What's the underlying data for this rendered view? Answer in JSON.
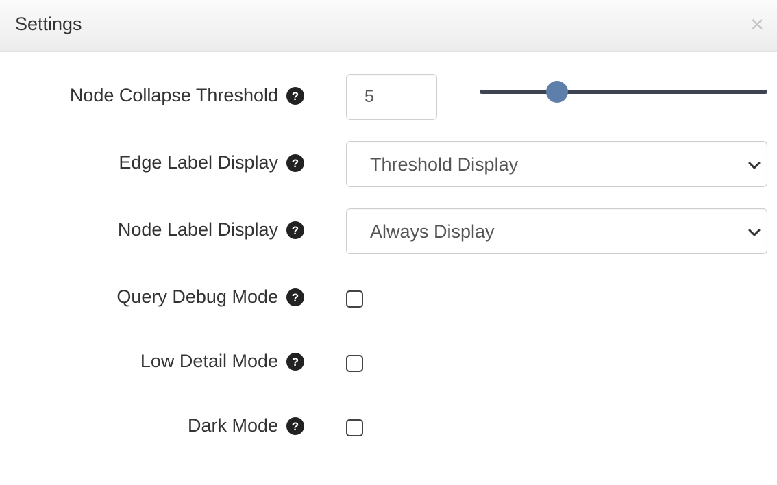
{
  "dialog": {
    "title": "Settings",
    "close_glyph": "×"
  },
  "settings": {
    "node_collapse_threshold": {
      "label": "Node Collapse Threshold",
      "value": "5",
      "slider_fraction": 0.27
    },
    "edge_label_display": {
      "label": "Edge Label Display",
      "selected": "Threshold Display"
    },
    "node_label_display": {
      "label": "Node Label Display",
      "selected": "Always Display"
    },
    "query_debug_mode": {
      "label": "Query Debug Mode",
      "checked": false
    },
    "low_detail_mode": {
      "label": "Low Detail Mode",
      "checked": false
    },
    "dark_mode": {
      "label": "Dark Mode",
      "checked": false
    }
  },
  "icons": {
    "help": "question-circle-icon",
    "chevron": "chevron-down-icon",
    "close": "close-icon"
  },
  "colors": {
    "slider_thumb": "#5d7fa9",
    "slider_track": "#3d4350",
    "help_icon": "#222222"
  }
}
